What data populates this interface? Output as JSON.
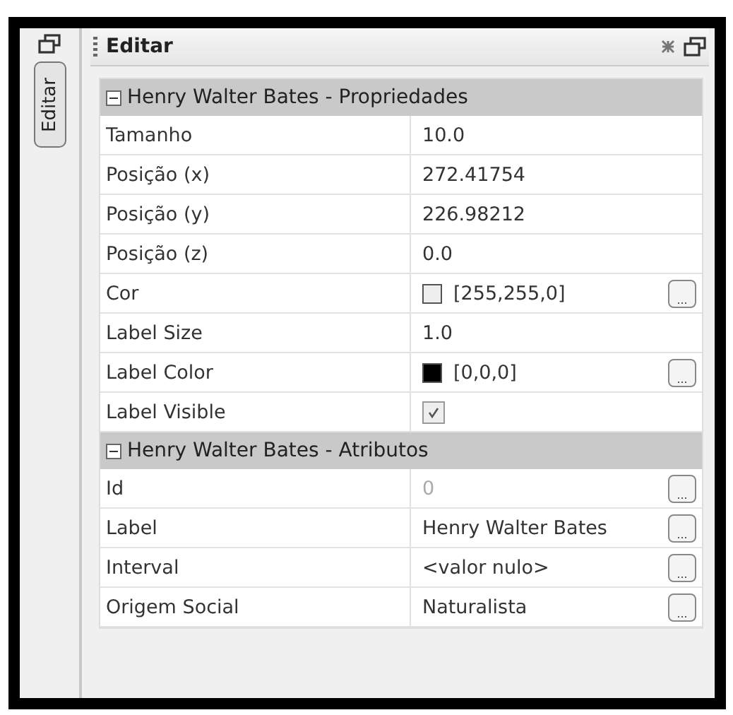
{
  "side_tab": {
    "label": "Editar",
    "selected": true
  },
  "panel": {
    "title": "Editar"
  },
  "sections": [
    {
      "title": "Henry Walter Bates - Propriedades",
      "expanded": true,
      "rows": [
        {
          "kind": "text",
          "name": "Tamanho",
          "value": "10.0",
          "disabled": false
        },
        {
          "kind": "text",
          "name": "Posição (x)",
          "value": "272.41754",
          "disabled": false
        },
        {
          "kind": "text",
          "name": "Posição (y)",
          "value": "226.98212",
          "disabled": false
        },
        {
          "kind": "text",
          "name": "Posição (z)",
          "value": "0.0",
          "disabled": false
        },
        {
          "kind": "color",
          "name": "Cor",
          "value": "[255,255,0]",
          "color": "#eeeeee",
          "button": "...",
          "disabled": false
        },
        {
          "kind": "text",
          "name": "Label Size",
          "value": "1.0",
          "disabled": false
        },
        {
          "kind": "color",
          "name": "Label Color",
          "value": "[0,0,0]",
          "color": "#000000",
          "button": "...",
          "disabled": false
        },
        {
          "kind": "checkbox",
          "name": "Label Visible",
          "checked": true,
          "disabled": false
        }
      ]
    },
    {
      "title": "Henry Walter Bates - Atributos",
      "expanded": true,
      "rows": [
        {
          "kind": "text",
          "name": "Id",
          "value": "0",
          "button": "...",
          "disabled": true
        },
        {
          "kind": "text",
          "name": "Label",
          "value": "Henry Walter Bates",
          "button": "...",
          "disabled": false
        },
        {
          "kind": "text",
          "name": "Interval",
          "value": "<valor nulo>",
          "button": "...",
          "disabled": false
        },
        {
          "kind": "text",
          "name": "Origem Social",
          "value": "Naturalista",
          "button": "...",
          "disabled": false
        }
      ]
    }
  ]
}
